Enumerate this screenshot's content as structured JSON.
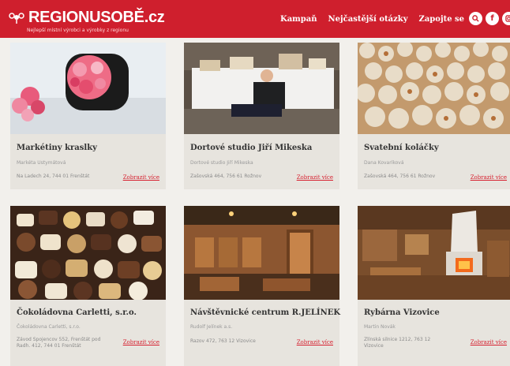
{
  "header": {
    "logo_text": "REGIONUSOBĚ.cz",
    "logo_subtitle": "Nejlepší místní výrobci a výrobky z regionu",
    "nav": [
      "Kampaň",
      "Nejčastější otázky",
      "Zapojte se"
    ],
    "social_icons": [
      "search-icon",
      "facebook-icon",
      "instagram-icon"
    ]
  },
  "colors": {
    "brand_red": "#cf1f2d",
    "card_bg": "#e7e4de",
    "page_bg": "#f2f0ec"
  },
  "cards": [
    {
      "title": "Markétiny kraslky",
      "subtitle": "Markéta Ustymátová",
      "address": "Na Ladech 24, 744 01 Frenštát",
      "link": "Zobrazit více"
    },
    {
      "title": "Dortové studio Jiří Mikeska",
      "subtitle": "Dortové studio Jiří Mikeska",
      "address": "Zašovská 464, 756 61 Rožnov",
      "link": "Zobrazit více"
    },
    {
      "title": "Svatební koláčky",
      "subtitle": "Dana Kovaríková",
      "address": "Zašovská 464, 756 61 Rožnov",
      "link": "Zobrazit více"
    },
    {
      "title": "Čokoládovna Carletti, s.r.o.",
      "subtitle": "Čokoládovna Carletti, s.r.o.",
      "address": "Závod Spojencov 552, Frenštát pod Radh. 412, 744 01 Frenštát",
      "link": "Zobrazit více"
    },
    {
      "title": "Návštěvnické centrum R.JELÍNEK",
      "subtitle": "Rudolf Jelínek a.s.",
      "address": "Razov 472, 763 12 Vizovice",
      "link": "Zobrazit více"
    },
    {
      "title": "Rybárna Vizovice",
      "subtitle": "Martin Novák",
      "address": "Zlínská silnice 1212, 763 12 Vizovice",
      "link": "Zobrazit více"
    }
  ]
}
